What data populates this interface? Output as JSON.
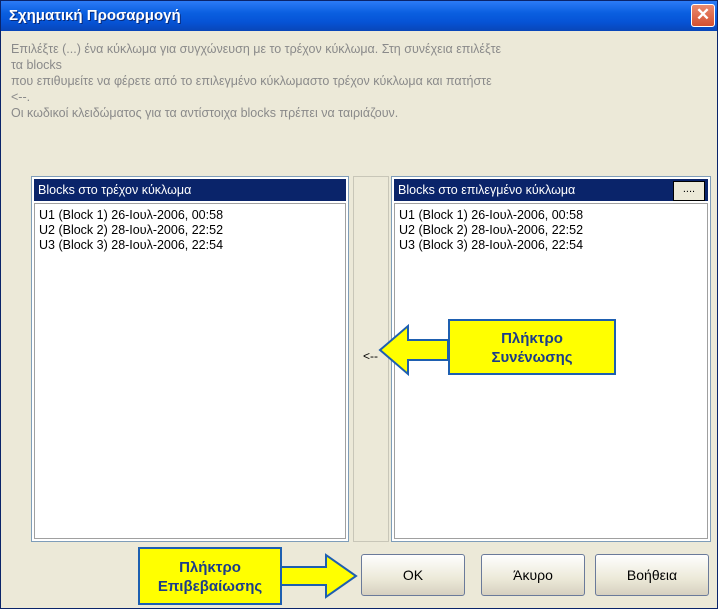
{
  "window": {
    "title": "Σχηματική Προσαρμογή",
    "close_glyph": "✕"
  },
  "instructions": {
    "line1": "Επιλέξτε (...) ένα κύκλωμα για συγχώνευση με το τρέχον κύκλωμα. Στη συνέχεια επιλέξτε",
    "line2": "τα blocks",
    "line3": "που επιθυμείτε να φέρετε από το επιλεγμένο κύκλωμαστο τρέχον κύκλωμα και πατήστε",
    "line4": "<--.",
    "line5": "Οι κωδικοί κλειδώματος για τα αντίστοιχα blocks πρέπει να ταιριάζουν."
  },
  "left_panel": {
    "header": "Blocks στο τρέχον κύκλωμα",
    "items": [
      "U1 (Block 1) 26-Ιουλ-2006, 00:58",
      "U2 (Block 2) 28-Ιουλ-2006, 22:52",
      "U3 (Block 3) 28-Ιουλ-2006, 22:54"
    ]
  },
  "right_panel": {
    "header": "Blocks στο επιλεγμένο κύκλωμα",
    "browse_label": "....",
    "items": [
      "U1 (Block 1) 26-Ιουλ-2006, 00:58",
      "U2 (Block 2) 28-Ιουλ-2006, 22:52",
      "U3 (Block 3) 28-Ιουλ-2006, 22:54"
    ]
  },
  "join_button": {
    "label": "<--"
  },
  "buttons": {
    "ok": "OK",
    "cancel": "Άκυρο",
    "help": "Βοήθεια"
  },
  "callouts": {
    "join_line1": "Πλήκτρο",
    "join_line2": "Συνένωσης",
    "ok_line1": "Πλήκτρο",
    "ok_line2": "Επιβεβαίωσης"
  },
  "colors": {
    "title_bar": "#0653d6",
    "list_header": "#0a246a",
    "callout_fill": "#ffff00",
    "callout_border": "#1e5fb0",
    "callout_text": "#1b3c8a"
  },
  "icons": {
    "close": "close-icon",
    "join_arrow": "arrow-left-icon",
    "ok_arrow": "arrow-right-icon"
  }
}
